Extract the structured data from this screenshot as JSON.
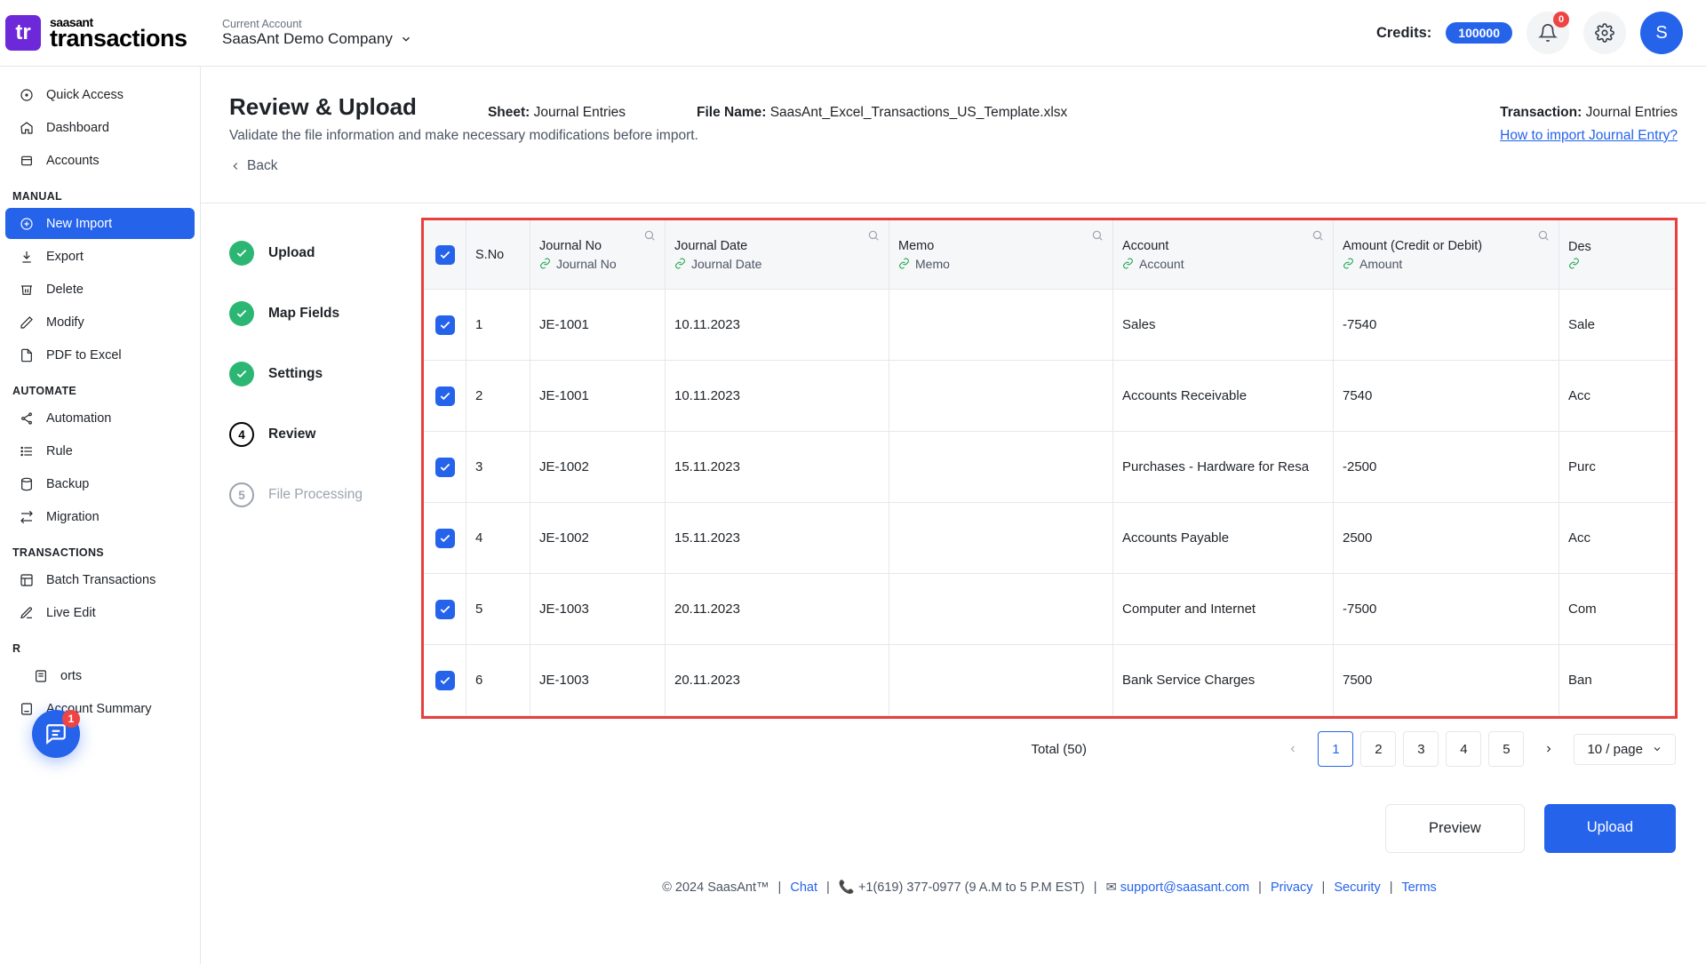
{
  "logo": {
    "badge": "tr",
    "brand_top": "saasant",
    "brand_bottom": "transactions"
  },
  "header": {
    "account_label": "Current Account",
    "account_name": "SaasAnt Demo Company",
    "credits_label": "Credits:",
    "credits_value": "100000",
    "notif_count": "0",
    "avatar_letter": "S"
  },
  "sidebar": {
    "items_top": [
      {
        "label": "Quick Access"
      },
      {
        "label": "Dashboard"
      },
      {
        "label": "Accounts"
      }
    ],
    "heading_manual": "MANUAL",
    "items_manual": [
      {
        "label": "New Import",
        "active": true
      },
      {
        "label": "Export"
      },
      {
        "label": "Delete"
      },
      {
        "label": "Modify"
      },
      {
        "label": "PDF to Excel"
      }
    ],
    "heading_automate": "AUTOMATE",
    "items_automate": [
      {
        "label": "Automation"
      },
      {
        "label": "Rule"
      },
      {
        "label": "Backup"
      },
      {
        "label": "Migration"
      }
    ],
    "heading_transactions": "TRANSACTIONS",
    "items_transactions": [
      {
        "label": "Batch Transactions"
      },
      {
        "label": "Live Edit"
      }
    ],
    "heading_reports_trunc": "R",
    "items_reports": [
      {
        "label": "orts"
      },
      {
        "label": "Account Summary"
      }
    ],
    "chat_badge": "1"
  },
  "page": {
    "title": "Review & Upload",
    "sheet_label": "Sheet:",
    "sheet_value": "Journal Entries",
    "file_label": "File Name:",
    "file_value": "SaasAnt_Excel_Transactions_US_Template.xlsx",
    "txn_label": "Transaction:",
    "txn_value": "Journal Entries",
    "subtitle": "Validate the file information and make necessary modifications before import.",
    "help_link": "How to import Journal Entry?",
    "back": "Back"
  },
  "steps": [
    {
      "label": "Upload",
      "state": "done"
    },
    {
      "label": "Map Fields",
      "state": "done"
    },
    {
      "label": "Settings",
      "state": "done"
    },
    {
      "label": "Review",
      "state": "active",
      "num": "4"
    },
    {
      "label": "File Processing",
      "state": "pending",
      "num": "5"
    }
  ],
  "table": {
    "columns": {
      "sno": "S.No",
      "jno": {
        "top": "Journal No",
        "sub": "Journal No"
      },
      "jdate": {
        "top": "Journal Date",
        "sub": "Journal Date"
      },
      "memo": {
        "top": "Memo",
        "sub": "Memo"
      },
      "acct": {
        "top": "Account",
        "sub": "Account"
      },
      "amt": {
        "top": "Amount (Credit or Debit)",
        "sub": "Amount"
      },
      "desc": "Des"
    },
    "rows": [
      {
        "sno": "1",
        "jno": "JE-1001",
        "jdate": "10.11.2023",
        "memo": "",
        "acct": "Sales",
        "amt": "-7540",
        "desc": "Sale"
      },
      {
        "sno": "2",
        "jno": "JE-1001",
        "jdate": "10.11.2023",
        "memo": "",
        "acct": "Accounts Receivable",
        "amt": "7540",
        "desc": "Acc"
      },
      {
        "sno": "3",
        "jno": "JE-1002",
        "jdate": "15.11.2023",
        "memo": "",
        "acct": "Purchases - Hardware for Resa",
        "amt": "-2500",
        "desc": "Purc"
      },
      {
        "sno": "4",
        "jno": "JE-1002",
        "jdate": "15.11.2023",
        "memo": "",
        "acct": "Accounts Payable",
        "amt": "2500",
        "desc": "Acc"
      },
      {
        "sno": "5",
        "jno": "JE-1003",
        "jdate": "20.11.2023",
        "memo": "",
        "acct": "Computer and Internet",
        "amt": "-7500",
        "desc": "Com"
      },
      {
        "sno": "6",
        "jno": "JE-1003",
        "jdate": "20.11.2023",
        "memo": "",
        "acct": "Bank Service Charges",
        "amt": "7500",
        "desc": "Ban"
      }
    ]
  },
  "pagination": {
    "total": "Total (50)",
    "pages": [
      "1",
      "2",
      "3",
      "4",
      "5"
    ],
    "per_page": "10 / page"
  },
  "actions": {
    "preview": "Preview",
    "upload": "Upload"
  },
  "footer": {
    "copyright": "© 2024 SaasAnt™",
    "chat": "Chat",
    "phone": "+1(619) 377-0977 (9 A.M to 5 P.M EST)",
    "email": "support@saasant.com",
    "privacy": "Privacy",
    "security": "Security",
    "terms": "Terms"
  }
}
